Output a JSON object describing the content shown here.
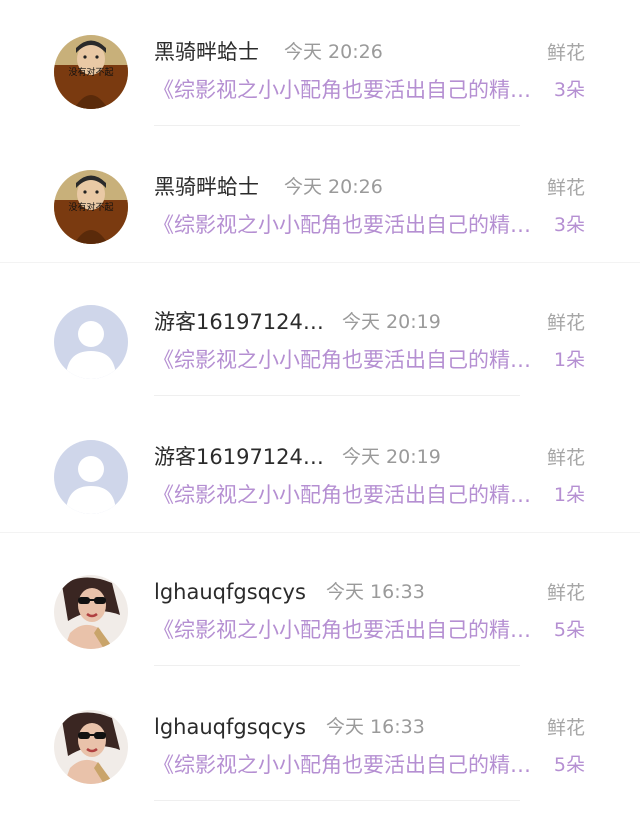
{
  "colors": {
    "name": "#2b2b2b",
    "time": "#9a9a9a",
    "book_title": "#b58fd2",
    "gift_label": "#a6a6a6"
  },
  "entries": [
    {
      "username": "黑骑畔蛤士",
      "time": "今天 20:26",
      "book_title": "《综影视之小小配角也要活出自己的精彩》",
      "gift_label": "鲜花",
      "gift_count": "3朵",
      "avatar_icon": "boy-photo-avatar-icon",
      "avatar_caption": "没有对不起"
    },
    {
      "username": "黑骑畔蛤士",
      "time": "今天 20:26",
      "book_title": "《综影视之小小配角也要活出自己的精彩》",
      "gift_label": "鲜花",
      "gift_count": "3朵",
      "avatar_icon": "boy-photo-avatar-icon",
      "avatar_caption": "没有对不起"
    },
    {
      "username": "游客16197124…",
      "time": "今天 20:19",
      "book_title": "《综影视之小小配角也要活出自己的精彩》",
      "gift_label": "鲜花",
      "gift_count": "1朵",
      "avatar_icon": "default-user-avatar-icon"
    },
    {
      "username": "游客16197124…",
      "time": "今天 20:19",
      "book_title": "《综影视之小小配角也要活出自己的精彩》",
      "gift_label": "鲜花",
      "gift_count": "1朵",
      "avatar_icon": "default-user-avatar-icon"
    },
    {
      "username": "lghauqfgsqcys",
      "time": "今天 16:33",
      "book_title": "《综影视之小小配角也要活出自己的精彩》",
      "gift_label": "鲜花",
      "gift_count": "5朵",
      "avatar_icon": "girl-sunglasses-avatar-icon"
    },
    {
      "username": "lghauqfgsqcys",
      "time": "今天 16:33",
      "book_title": "《综影视之小小配角也要活出自己的精彩》",
      "gift_label": "鲜花",
      "gift_count": "5朵",
      "avatar_icon": "girl-sunglasses-avatar-icon"
    }
  ]
}
